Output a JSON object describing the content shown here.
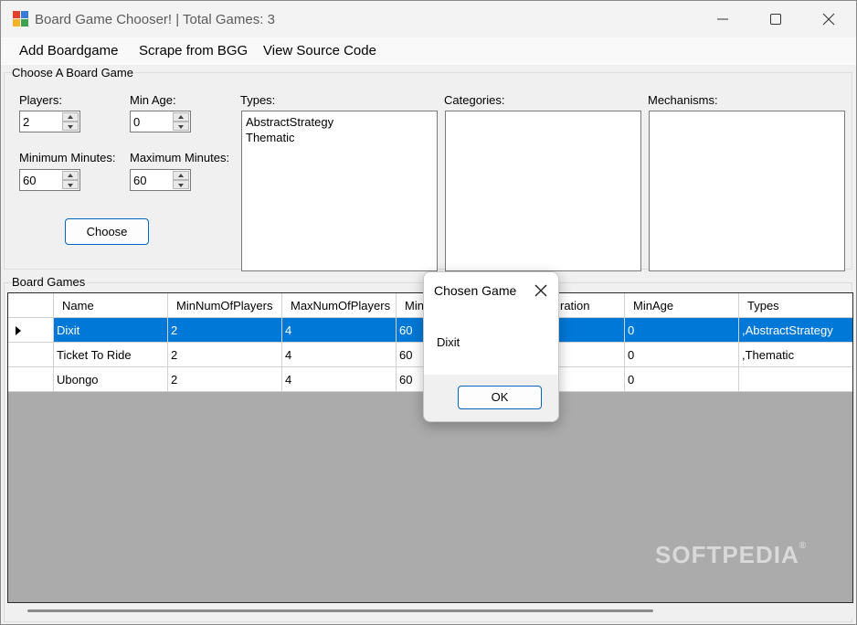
{
  "window": {
    "title": "Board Game Chooser! | Total Games: 3"
  },
  "menu": {
    "items": [
      "Add Boardgame",
      "Scrape from BGG",
      "View Source Code"
    ]
  },
  "chooser": {
    "group_title": "Choose A Board Game",
    "players_label": "Players:",
    "players_value": "2",
    "min_age_label": "Min Age:",
    "min_age_value": "0",
    "min_minutes_label": "Minimum Minutes:",
    "min_minutes_value": "60",
    "max_minutes_label": "Maximum Minutes:",
    "max_minutes_value": "60",
    "choose_button": "Choose",
    "types_label": "Types:",
    "types_items": [
      "AbstractStrategy",
      "Thematic"
    ],
    "categories_label": "Categories:",
    "mechanisms_label": "Mechanisms:"
  },
  "board_games": {
    "group_title": "Board Games",
    "columns": [
      "Name",
      "MinNumOfPlayers",
      "MaxNumOfPlayers",
      "Min",
      "ration",
      "MinAge",
      "Types"
    ],
    "rows": [
      [
        "Dixit",
        "2",
        "4",
        "60",
        "",
        "0",
        ",AbstractStrategy"
      ],
      [
        "Ticket To Ride",
        "2",
        "4",
        "60",
        "",
        "0",
        ",Thematic"
      ],
      [
        "Ubongo",
        "2",
        "4",
        "60",
        "",
        "0",
        ""
      ]
    ]
  },
  "dialog": {
    "title": "Chosen Game",
    "message": "Dixit",
    "ok_button": "OK"
  },
  "watermark": {
    "text": "SOFTPEDIA",
    "mark": "®"
  },
  "colors": {
    "selection": "#0078d7",
    "button_border": "#0067c0",
    "grid_background": "#ababab"
  }
}
